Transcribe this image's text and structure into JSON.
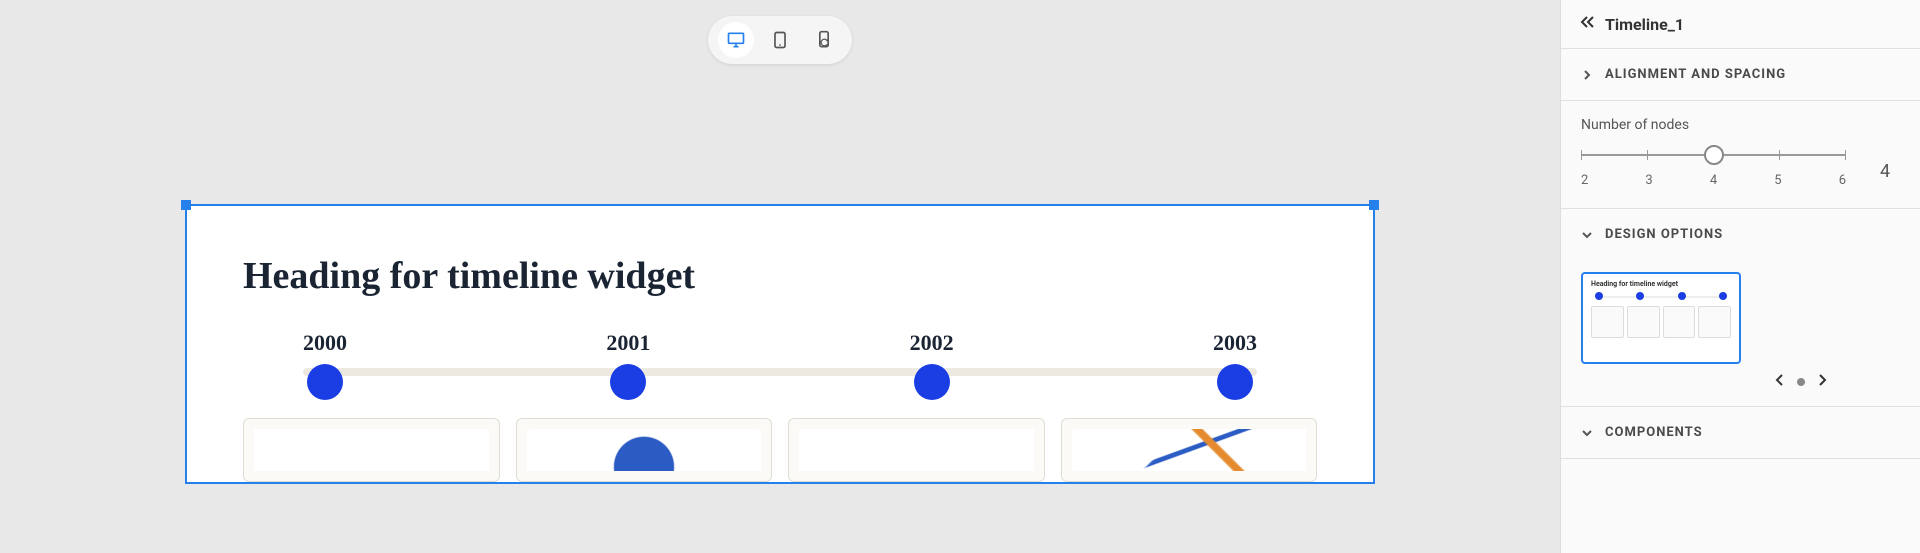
{
  "devices": {
    "desktop": "desktop",
    "tablet": "tablet",
    "mobile": "mobile-refresh"
  },
  "widget": {
    "heading": "Heading for timeline widget",
    "years": [
      "2000",
      "2001",
      "2002",
      "2003"
    ]
  },
  "panel": {
    "title": "Timeline_1",
    "sections": {
      "alignment": "ALIGNMENT AND SPACING",
      "design": "DESIGN OPTIONS",
      "components": "COMPONENTS"
    },
    "slider": {
      "label": "Number of nodes",
      "min": "2",
      "ticks": [
        "2",
        "3",
        "4",
        "5",
        "6"
      ],
      "value": "4"
    },
    "preview_heading": "Heading for timeline widget"
  }
}
